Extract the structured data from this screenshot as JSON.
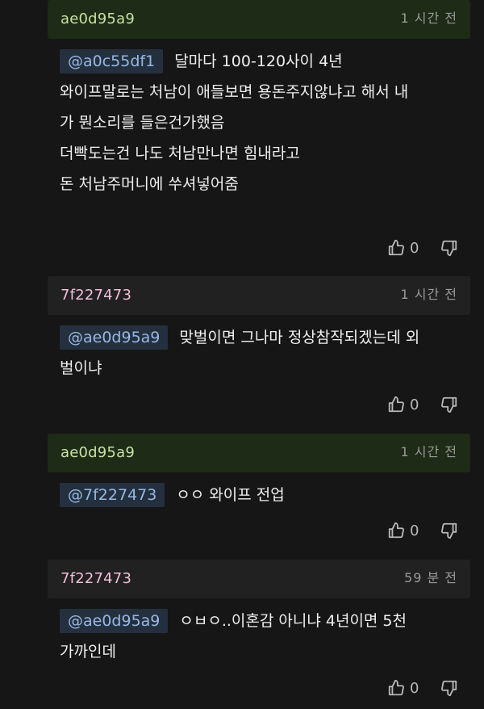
{
  "comments": [
    {
      "author": "ae0d95a9",
      "time": "1 시간 전",
      "mention": "@a0c55df1",
      "lines": [
        "달마다 100-120사이 4년",
        "와이프말로는 처남이 애들보면 용돈주지않냐고 해서 내",
        "가 뭔소리를 들은건가했음",
        "더빡도는건 나도 처남만나면 힘내라고",
        "돈 처남주머니에 쑤셔넣어줌"
      ],
      "likes": "0"
    },
    {
      "author": "7f227473",
      "time": "1 시간 전",
      "mention": "@ae0d95a9",
      "lines": [
        "맞벌이면 그나마 정상참작되겠는데 외",
        "벌이냐"
      ],
      "likes": "0"
    },
    {
      "author": "ae0d95a9",
      "time": "1 시간 전",
      "mention": "@7f227473",
      "lines": [
        "ㅇㅇ 와이프 전업"
      ],
      "likes": "0"
    },
    {
      "author": "7f227473",
      "time": "59 분 전",
      "mention": "@ae0d95a9",
      "lines": [
        "ㅇㅂㅇ..이혼감 아니냐 4년이면 5천",
        "가까인데"
      ],
      "likes": "0"
    }
  ],
  "colors": {
    "background": "#161616",
    "author_green": "#c6e2a3",
    "author_pink": "#f3bedc",
    "mention_text": "#97b8e6",
    "mention_bg": "#25303e"
  },
  "icons": {
    "like": "thumbs-up-icon",
    "dislike": "thumbs-down-icon"
  }
}
